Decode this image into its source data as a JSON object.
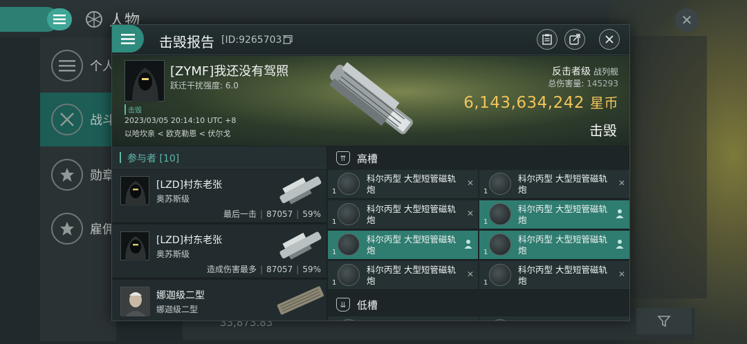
{
  "background": {
    "title": "人物",
    "side_items": [
      "个人",
      "战斗",
      "勋章",
      "雇佣"
    ],
    "bottom_value": "33,873.83"
  },
  "dialog": {
    "title": "击毁报告",
    "id": "[ID:9265703]",
    "header_icons": [
      "clipboard-icon",
      "share-icon",
      "close-icon"
    ]
  },
  "victim": {
    "name": "[ZYMF]我还没有驾照",
    "warp_interference": "跃迁干扰强度: 6.0",
    "tag": "击毁",
    "datetime": "2023/03/05 20:14:10 UTC +8",
    "location": "以哈坎亲 < 欧克勒恩 < 伏尔戈",
    "ship_class": "反击者级",
    "ship_type": "战列舰",
    "total_damage_label": "总伤害量:",
    "total_damage": "145293",
    "isk_value": "6,143,634,242",
    "isk_unit": "星币",
    "status": "击毁"
  },
  "participants": {
    "header": "参与者 [10]",
    "rows": [
      {
        "name": "[LZD]村东老张",
        "ship": "奥苏斯级",
        "role": "最后一击",
        "damage": "87057",
        "percent": "59%"
      },
      {
        "name": "[LZD]村东老张",
        "ship": "奥苏斯级",
        "role": "造成伤害最多",
        "damage": "87057",
        "percent": "59%"
      },
      {
        "name": "娜迦级二型",
        "ship": "娜迦级二型",
        "role": "",
        "damage": "",
        "percent": ""
      }
    ]
  },
  "modules": {
    "high_slot_label": "高槽",
    "low_slot_label": "低槽",
    "items": [
      {
        "name": "科尔丙型 大型短管磁轨炮",
        "qty": "1",
        "state": "destroyed"
      },
      {
        "name": "科尔丙型 大型短管磁轨炮",
        "qty": "1",
        "state": "destroyed"
      },
      {
        "name": "科尔丙型 大型短管磁轨炮",
        "qty": "1",
        "state": "destroyed"
      },
      {
        "name": "科尔丙型 大型短管磁轨炮",
        "qty": "1",
        "state": "dropped"
      },
      {
        "name": "科尔丙型 大型短管磁轨炮",
        "qty": "1",
        "state": "dropped"
      },
      {
        "name": "科尔丙型 大型短管磁轨炮",
        "qty": "1",
        "state": "dropped"
      },
      {
        "name": "科尔丙型 大型短管磁轨炮",
        "qty": "1",
        "state": "destroyed"
      },
      {
        "name": "科尔丙型 大型短管磁轨炮",
        "qty": "1",
        "state": "destroyed"
      }
    ],
    "x_mark": "✕"
  },
  "colors": {
    "accent": "#2f8b7e",
    "isk": "#f1c45a",
    "fitted_row": "#2f7c70"
  }
}
